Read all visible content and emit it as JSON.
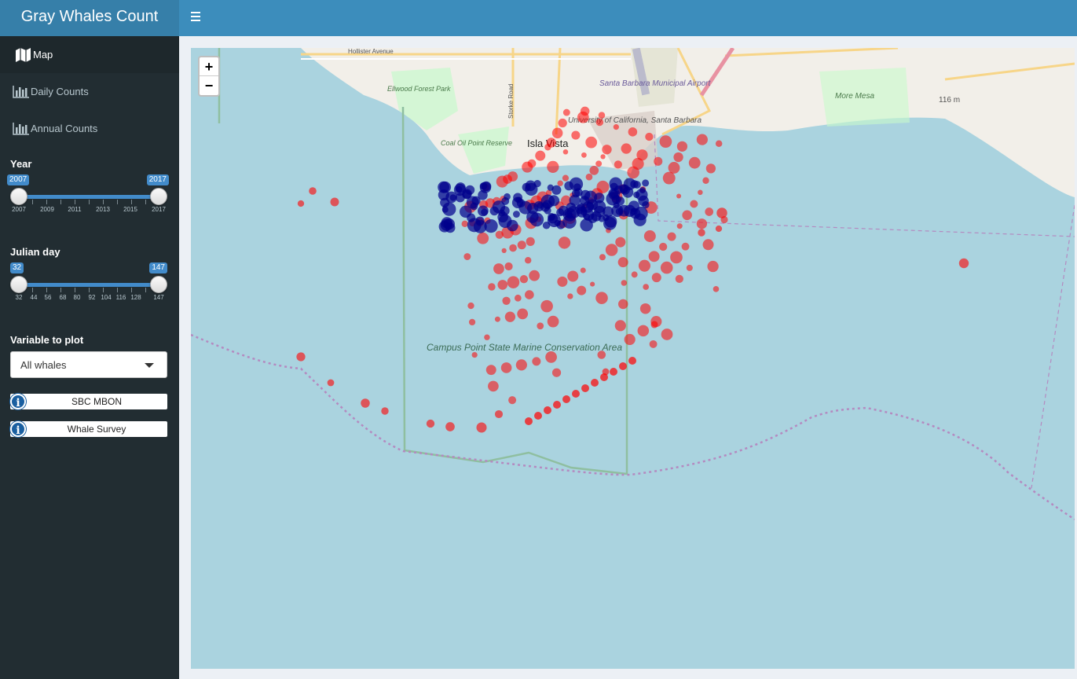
{
  "app": {
    "title": "Gray Whales Count"
  },
  "menu": [
    {
      "label": "Map",
      "icon": "map-icon",
      "active": true
    },
    {
      "label": "Daily Counts",
      "icon": "bar-chart-icon",
      "active": false
    },
    {
      "label": "Annual Counts",
      "icon": "bar-chart-icon",
      "active": false
    }
  ],
  "year_slider": {
    "label": "Year",
    "min": 2007,
    "max": 2017,
    "from": 2007,
    "to": 2017,
    "from_label": "2007",
    "to_label": "2017",
    "ticks": [
      "2007",
      "2009",
      "2011",
      "2013",
      "2015",
      "2017"
    ]
  },
  "julian_slider": {
    "label": "Julian day",
    "min": 32,
    "max": 147,
    "from": 32,
    "to": 147,
    "from_label": "32",
    "to_label": "147",
    "ticks": [
      "32",
      "44",
      "56",
      "68",
      "80",
      "92",
      "104",
      "116",
      "128",
      "147"
    ]
  },
  "variable": {
    "label": "Variable to plot",
    "selected": "All whales"
  },
  "links": [
    {
      "label": "SBC MBON",
      "icon": "info-icon"
    },
    {
      "label": "Whale Survey",
      "icon": "info-icon"
    }
  ],
  "map": {
    "zoom_in": "+",
    "zoom_out": "−",
    "place_labels": {
      "isla_vista": "Isla Vista",
      "ucsb": "University of California, Santa Barbara",
      "airport": "Santa Barbara Municipal Airport",
      "coal_oil": "Coal Oil Point Reserve",
      "ellwood": "Ellwood Forest Park",
      "more_mesa": "More Mesa",
      "elevation": "116 m",
      "hollister": "Hollister Avenue",
      "storke": "Storke Road",
      "mpa": "Campus Point State Marine Conservation Area"
    },
    "colors": {
      "ocean": "#aad3df",
      "land": "#f2efe9",
      "series_a": "#ff0000",
      "series_b": "#00008b"
    }
  }
}
